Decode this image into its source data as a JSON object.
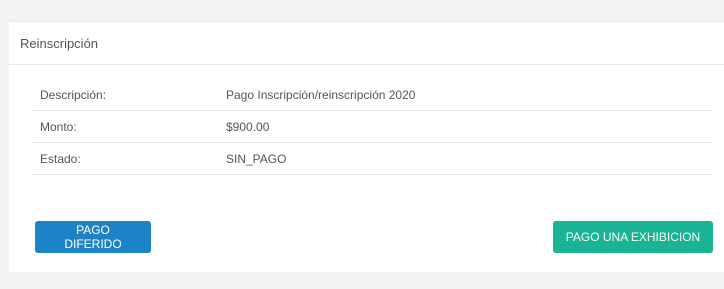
{
  "panel": {
    "title": "Reinscripción"
  },
  "details": [
    {
      "label": "Descripción:",
      "value": "Pago Inscripción/reinscripción 2020"
    },
    {
      "label": "Monto:",
      "value": "$900.00"
    },
    {
      "label": "Estado:",
      "value": "SIN_PAGO"
    }
  ],
  "actions": {
    "deferred_label": "PAGO DIFERIDO",
    "single_label": "PAGO UNA EXHIBICION"
  },
  "colors": {
    "deferred_button": "#1c84c6",
    "single_button": "#1ab394"
  }
}
